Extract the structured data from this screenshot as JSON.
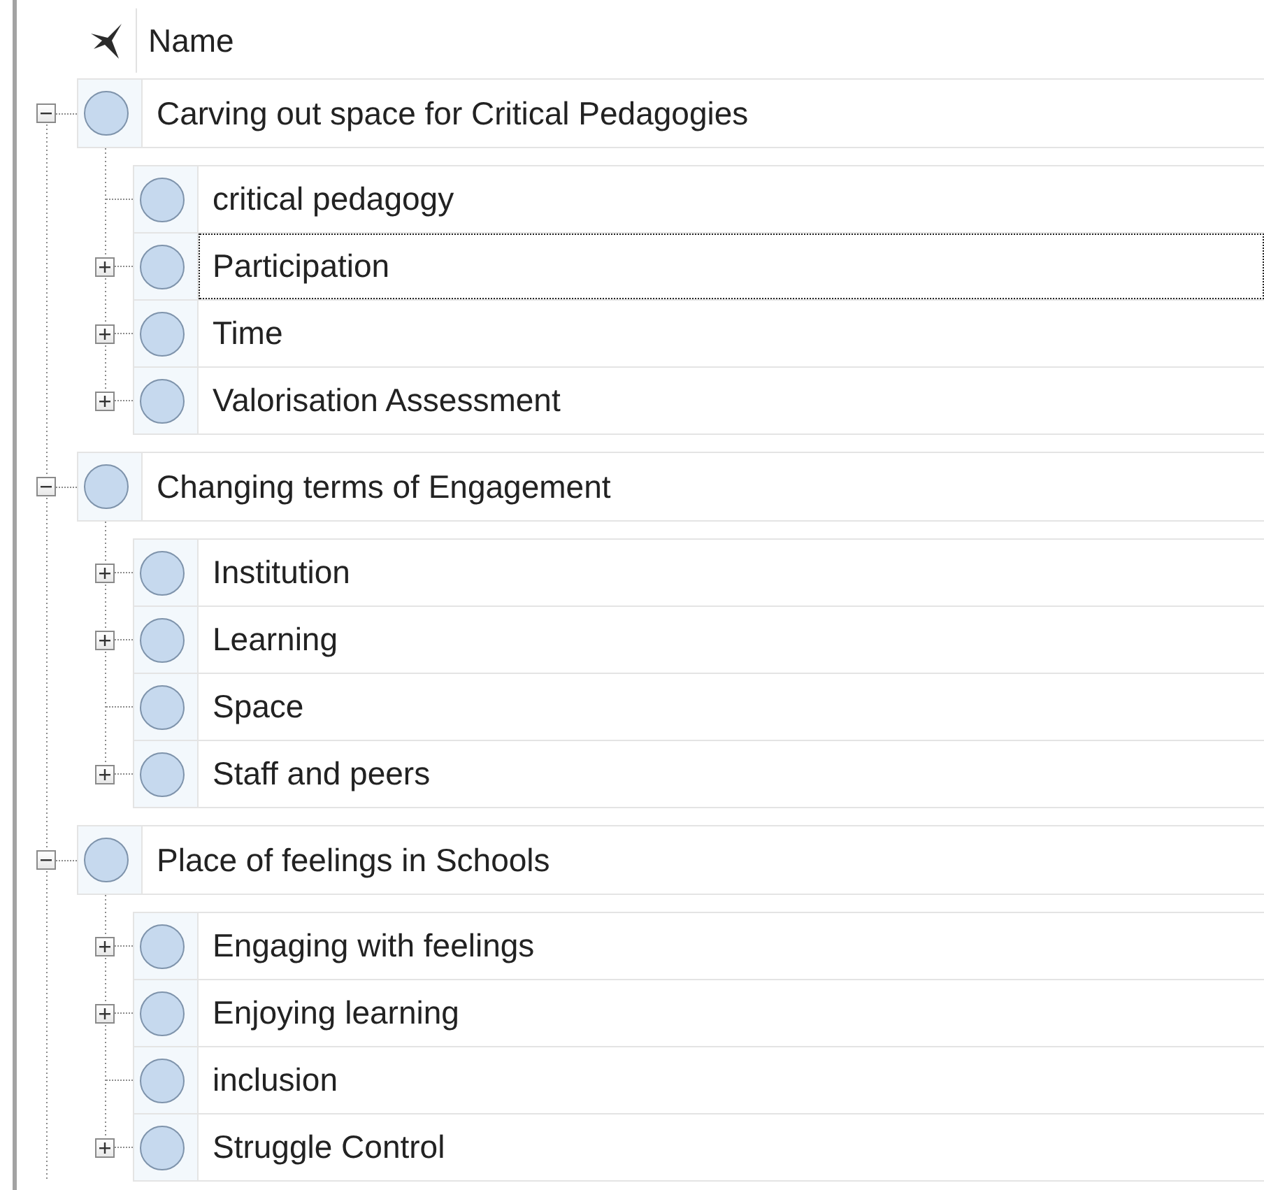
{
  "header": {
    "column": "Name"
  },
  "groups": [
    {
      "name": "Carving out space for Critical Pedagogies",
      "expanded": true,
      "focused": false,
      "children": [
        {
          "name": "critical pedagogy",
          "kind": "leaf",
          "focused": false
        },
        {
          "name": "Participation",
          "kind": "branch",
          "expanded": false,
          "focused": true
        },
        {
          "name": "Time",
          "kind": "branch",
          "expanded": false,
          "focused": false
        },
        {
          "name": "Valorisation Assessment",
          "kind": "branch",
          "expanded": false,
          "focused": false
        }
      ]
    },
    {
      "name": "Changing terms of Engagement",
      "expanded": true,
      "focused": false,
      "children": [
        {
          "name": "Institution",
          "kind": "branch",
          "expanded": false,
          "focused": false
        },
        {
          "name": "Learning",
          "kind": "branch",
          "expanded": false,
          "focused": false
        },
        {
          "name": "Space",
          "kind": "leaf",
          "focused": false
        },
        {
          "name": "Staff and peers",
          "kind": "branch",
          "expanded": false,
          "focused": false
        }
      ]
    },
    {
      "name": "Place of feelings in Schools",
      "expanded": true,
      "focused": false,
      "children": [
        {
          "name": "Engaging with feelings",
          "kind": "branch",
          "expanded": false,
          "focused": false
        },
        {
          "name": "Enjoying learning",
          "kind": "branch",
          "expanded": false,
          "focused": false
        },
        {
          "name": "inclusion",
          "kind": "leaf",
          "focused": false
        },
        {
          "name": "Struggle Control",
          "kind": "branch",
          "expanded": false,
          "focused": false
        }
      ]
    }
  ]
}
